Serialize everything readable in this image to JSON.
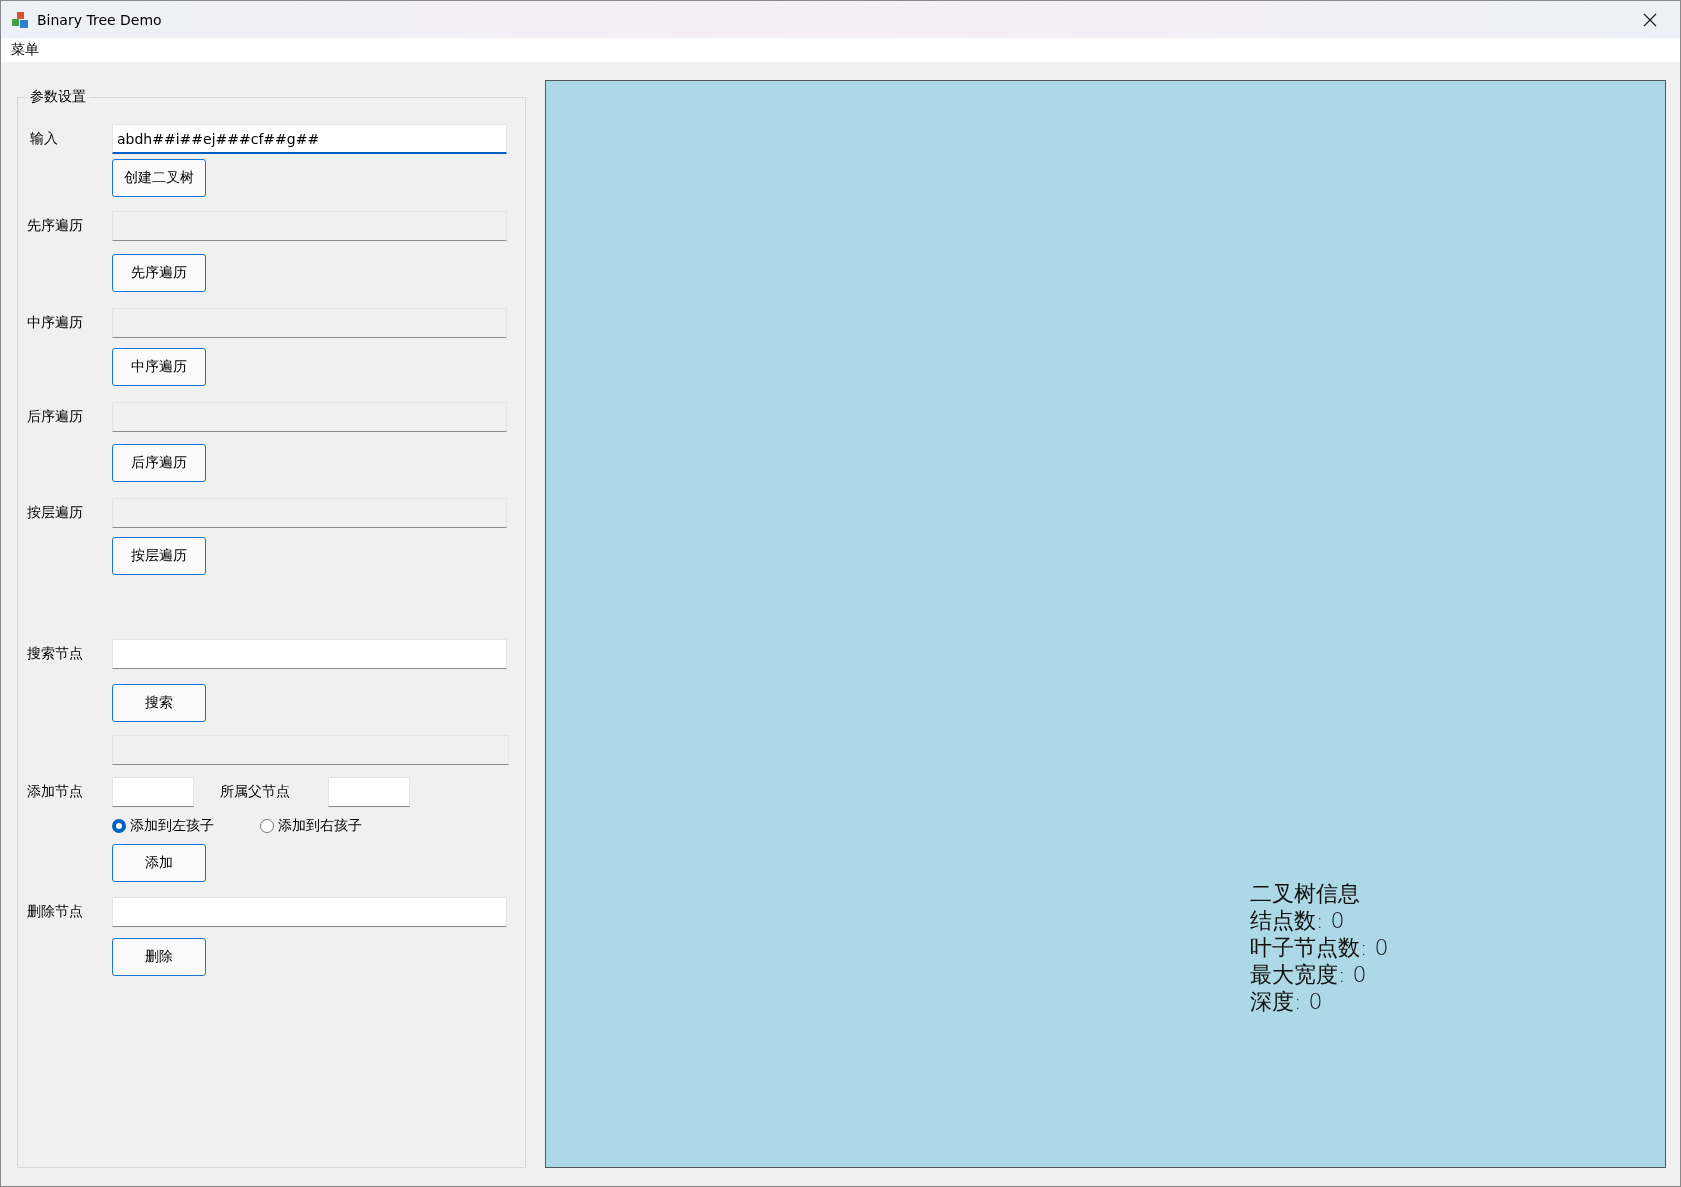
{
  "window": {
    "title": "Binary Tree Demo"
  },
  "menu": [
    {
      "label": "菜单"
    }
  ],
  "settings": {
    "title": "参数设置",
    "input": {
      "label": "输入",
      "value": "abdh##i##ej###cf##g##",
      "button": "创建二叉树"
    },
    "traversals": [
      {
        "label": "先序遍历",
        "button": "先序遍历"
      },
      {
        "label": "中序遍历",
        "button": "中序遍历"
      },
      {
        "label": "后序遍历",
        "button": "后序遍历"
      },
      {
        "label": "按层遍历",
        "button": "按层遍历"
      }
    ],
    "search": {
      "label": "搜索节点",
      "button": "搜索"
    },
    "add": {
      "label": "添加节点",
      "parent_label": "所属父节点",
      "options": [
        {
          "label": "添加到左孩子",
          "selected": true
        },
        {
          "label": "添加到右孩子",
          "selected": false
        }
      ],
      "button": "添加"
    },
    "delete": {
      "label": "删除节点",
      "button": "删除"
    }
  },
  "info": {
    "title": "二叉树信息",
    "lines": [
      "结点数: 0",
      "叶子节点数: 0",
      "最大宽度: 0",
      "深度: 0"
    ]
  }
}
